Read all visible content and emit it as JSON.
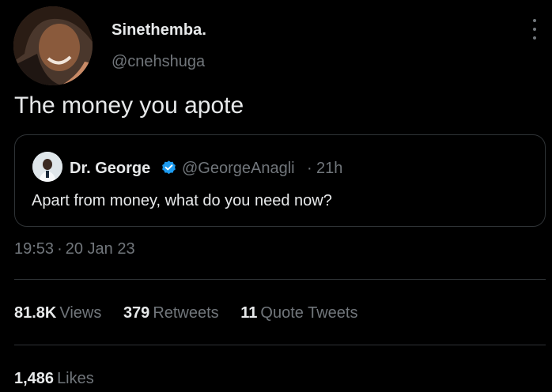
{
  "author": {
    "name": "Sinethemba.",
    "handle": "@cnehshuga"
  },
  "tweet": {
    "text": "The money you apote",
    "time": "19:53",
    "separator": "·",
    "date": "20 Jan 23"
  },
  "quoted_tweet": {
    "name": "Dr. George",
    "handle": "@GeorgeAnagli",
    "separator": "·",
    "time": "21h",
    "text": "Apart from money, what do you need now?"
  },
  "stats": {
    "views": {
      "count": "81.8K",
      "label": "Views"
    },
    "retweets": {
      "count": "379",
      "label": "Retweets"
    },
    "quote_tweets": {
      "count": "11",
      "label": "Quote Tweets"
    },
    "likes": {
      "count": "1,486",
      "label": "Likes"
    }
  },
  "icons": {
    "more": "more-options-icon",
    "verified": "verified-badge-icon"
  },
  "colors": {
    "background": "#000000",
    "primary_text": "#e7e9ea",
    "secondary_text": "#71767b",
    "border": "#2f3336",
    "verified": "#1d9bf0"
  }
}
